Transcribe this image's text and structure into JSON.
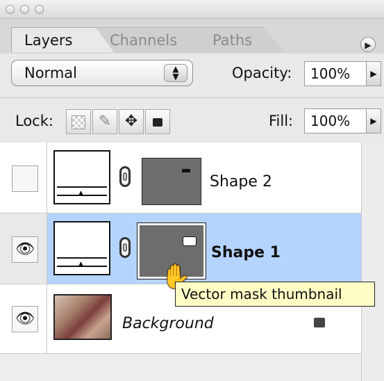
{
  "tabs": [
    {
      "label": "Layers",
      "active": true
    },
    {
      "label": "Channels",
      "active": false
    },
    {
      "label": "Paths",
      "active": false
    }
  ],
  "panel_menu_icon": "triangle-right-icon",
  "blend_mode": {
    "value": "Normal"
  },
  "opacity": {
    "label": "Opacity:",
    "value": "100%"
  },
  "lock": {
    "label": "Lock:",
    "icons": [
      "transparency-lock-icon",
      "brush-icon",
      "move-icon",
      "padlock-icon"
    ]
  },
  "fill": {
    "label": "Fill:",
    "value": "100%"
  },
  "layers": [
    {
      "name": "Shape 2",
      "visible": false,
      "selected": false
    },
    {
      "name": "Shape 1",
      "visible": true,
      "selected": true
    },
    {
      "name": "Background",
      "visible": true,
      "selected": false,
      "locked": true
    }
  ],
  "tooltip": "Vector mask thumbnail",
  "colors": {
    "selection": "#b5d4fd",
    "tooltip_bg": "#ffffc5",
    "mask_gray": "#6d6d6d"
  }
}
